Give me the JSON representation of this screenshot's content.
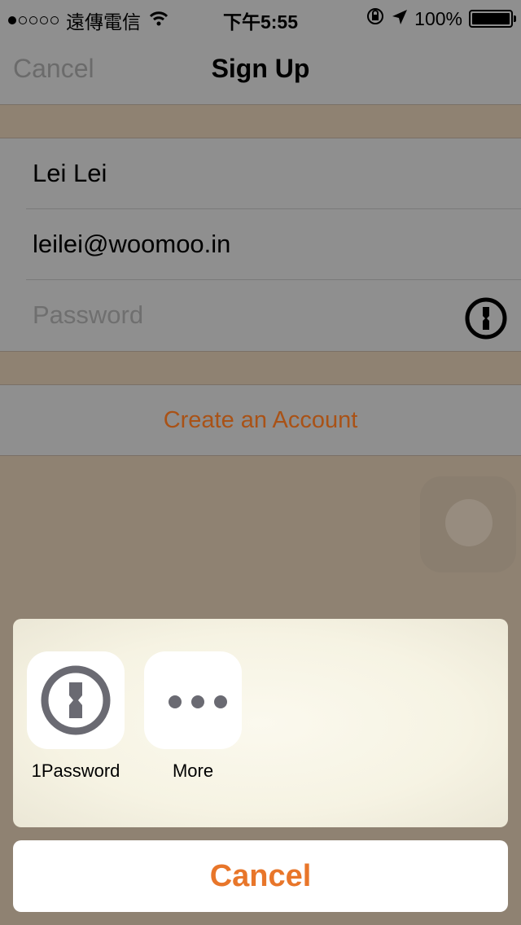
{
  "status_bar": {
    "carrier": "遠傳電信",
    "time": "下午5:55",
    "battery": "100%",
    "signal_bars_filled": 1,
    "signal_bars_total": 5
  },
  "nav": {
    "cancel_label": "Cancel",
    "title": "Sign Up"
  },
  "form": {
    "name_value": "Lei Lei",
    "email_value": "leilei@woomoo.in",
    "password_placeholder": "Password",
    "create_label": "Create an Account"
  },
  "share_sheet": {
    "apps": [
      {
        "label": "1Password",
        "icon": "1password-icon"
      },
      {
        "label": "More",
        "icon": "more-icon"
      }
    ],
    "cancel_label": "Cancel"
  },
  "colors": {
    "accent": "#e8762a",
    "create_text": "#a95216"
  }
}
